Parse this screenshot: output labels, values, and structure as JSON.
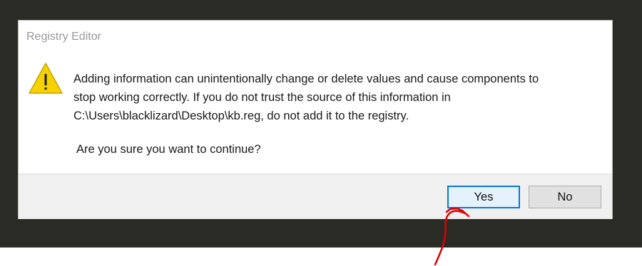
{
  "dialog": {
    "title": "Registry Editor",
    "icon": "warning-icon",
    "message_lines": [
      "Adding information can unintentionally change or delete values and cause components to",
      "stop working correctly. If you do not trust the source of this information in",
      "C:\\Users\\blacklizard\\Desktop\\kb.reg, do not add it to the registry."
    ],
    "question": "Are you sure you want to continue?",
    "buttons": {
      "yes_label": "Yes",
      "no_label": "No"
    }
  },
  "colors": {
    "backdrop": "#2b2b26",
    "warning_fill": "#f5d100",
    "focus_border": "#0a78d7",
    "annotation": "#e00000"
  }
}
